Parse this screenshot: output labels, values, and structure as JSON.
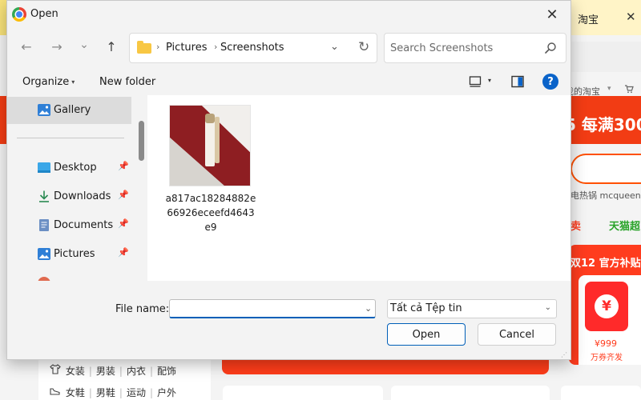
{
  "background": {
    "tab_title": "淘宝",
    "tab_close": "✕",
    "header_link": "我的淘宝",
    "header_caret": "▾",
    "cart_icon": "cart-icon",
    "banner_text": "5 每满300",
    "hot_searches": "电热锅   mcqueen",
    "promo_left": "卖",
    "promo_right": "天猫超",
    "card_title": "双12 官方补贴",
    "coupon_symbol": "¥",
    "coupon_price": "¥999",
    "coupon_sub": "万券齐发",
    "categories_row1": [
      "女装",
      "男装",
      "内衣",
      "配饰"
    ],
    "categories_row2": [
      "女鞋",
      "男鞋",
      "运动",
      "户外"
    ],
    "colors": {
      "taobao_orange": "#ff5000",
      "banner_red": "#f23c14"
    }
  },
  "dialog": {
    "title": "Open",
    "close_glyph": "✕",
    "nav": {
      "back_glyph": "←",
      "forward_glyph": "→",
      "recent_glyph": "⌄",
      "up_glyph": "↑"
    },
    "address": {
      "crumbs": [
        "Pictures",
        "Screenshots"
      ],
      "separator": "›",
      "dropdown_glyph": "⌄",
      "refresh_glyph": "↻"
    },
    "search": {
      "placeholder": "Search Screenshots"
    },
    "toolbar": {
      "organize": "Organize",
      "organize_caret": "▾",
      "new_folder": "New folder",
      "view_caret": "▾",
      "help_glyph": "?"
    },
    "sidebar": {
      "items": [
        {
          "label": "Gallery",
          "icon": "gallery-icon",
          "pinned": false,
          "selected": true
        },
        {
          "label": "Desktop",
          "icon": "desktop-icon",
          "pinned": true
        },
        {
          "label": "Downloads",
          "icon": "download-icon",
          "pinned": true
        },
        {
          "label": "Documents",
          "icon": "documents-icon",
          "pinned": true
        },
        {
          "label": "Pictures",
          "icon": "pictures-icon",
          "pinned": true
        }
      ],
      "pin_glyph": "📌"
    },
    "files": [
      {
        "name": "a817ac18284882e66926eceefd4643e9",
        "type": "image"
      }
    ],
    "footer": {
      "file_name_label": "File name:",
      "file_name_value": "",
      "file_name_dropdown": "⌄",
      "file_type": "Tất cả Tệp tin",
      "file_type_caret": "⌄",
      "open_label": "Open",
      "cancel_label": "Cancel"
    },
    "colors": {
      "accent": "#005fb8",
      "help": "#0a63c9",
      "folder": "#f8c743"
    }
  }
}
